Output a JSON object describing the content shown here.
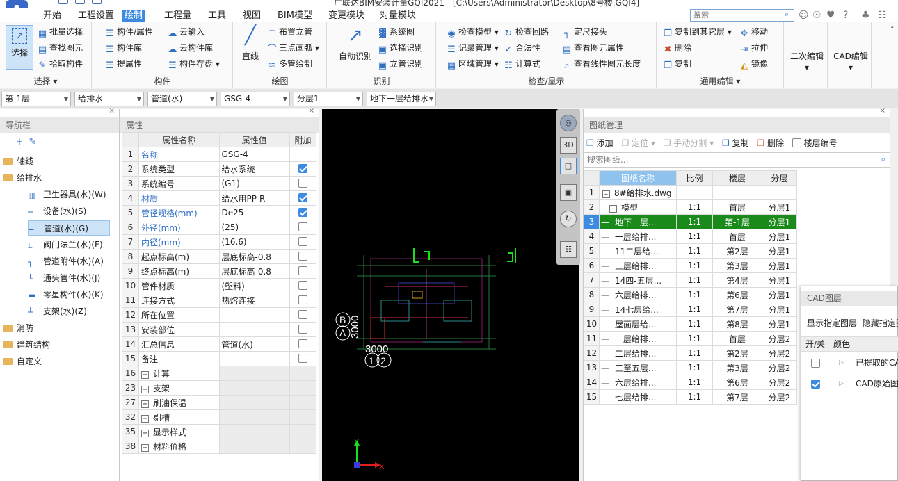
{
  "title": "广联达BIM安装计量GQI2021 - [C:\\Users\\Administrator\\Desktop\\8号楼.GQI4]",
  "menu": [
    "开始",
    "工程设置",
    "绘制",
    "工程量",
    "工具",
    "视图",
    "BIM模型",
    "变更模块",
    "对量模块"
  ],
  "search_placeholder": "搜索",
  "ribbon": {
    "select": {
      "label": "选择",
      "group": "选择 ▾"
    },
    "select_small": [
      "批量选择",
      "查找图元",
      "拾取构件"
    ],
    "component": {
      "items": [
        "构件/属性",
        "构件库",
        "提属性",
        "云输入",
        "云构件库",
        "构件存盘 ▾"
      ],
      "group": "构件"
    },
    "draw": {
      "big": "直线",
      "items": [
        "布置立管",
        "三点画弧 ▾",
        "多管绘制"
      ],
      "group": "绘图"
    },
    "identify": {
      "big": "自动识别",
      "items": [
        "系统图",
        "选择识别",
        "立管识别"
      ],
      "group": "识别"
    },
    "check": {
      "items": [
        "检查模型 ▾",
        "记录管理 ▾",
        "区域管理 ▾",
        "检查回路",
        "合法性",
        "计算式",
        "定尺接头",
        "查看图元属性",
        "查看线性图元长度"
      ],
      "group": "检查/显示"
    },
    "edit": {
      "items": [
        "复制到其它层 ▾",
        "删除",
        "复制",
        "移动",
        "拉伸",
        "镜像"
      ],
      "group": "通用编辑 ▾"
    },
    "second": "二次编辑",
    "cad": "CAD编辑"
  },
  "combos": [
    "第-1层",
    "给排水",
    "管道(水)",
    "GSG-4",
    "分层1",
    "地下一层给排水"
  ],
  "nav": {
    "title": "导航栏",
    "items": [
      {
        "label": "轴线",
        "type": "folder"
      },
      {
        "label": "给排水",
        "type": "folder"
      },
      {
        "label": "卫生器具(水)(W)",
        "type": "sub",
        "icon": "sanitary-icon"
      },
      {
        "label": "设备(水)(S)",
        "type": "sub",
        "icon": "equipment-icon"
      },
      {
        "label": "管道(水)(G)",
        "type": "sub",
        "icon": "pipe-icon",
        "selected": true
      },
      {
        "label": "阀门法兰(水)(F)",
        "type": "sub",
        "icon": "valve-icon"
      },
      {
        "label": "管道附件(水)(A)",
        "type": "sub",
        "icon": "pipe-fitting-icon"
      },
      {
        "label": "通头管件(水)(J)",
        "type": "sub",
        "icon": "tee-icon"
      },
      {
        "label": "零星构件(水)(K)",
        "type": "sub",
        "icon": "misc-part-icon"
      },
      {
        "label": "支架(水)(Z)",
        "type": "sub",
        "icon": "bracket-icon"
      },
      {
        "label": "消防",
        "type": "folder"
      },
      {
        "label": "建筑结构",
        "type": "folder"
      },
      {
        "label": "自定义",
        "type": "folder"
      }
    ]
  },
  "attr": {
    "title": "属性",
    "headers": [
      "属性名称",
      "属性值",
      "附加"
    ],
    "rows": [
      {
        "n": "1",
        "name": "名称",
        "val": "GSG-4",
        "blue": true,
        "check": null
      },
      {
        "n": "2",
        "name": "系统类型",
        "val": "给水系统",
        "blue": false,
        "check": true
      },
      {
        "n": "3",
        "name": "系统编号",
        "val": "(G1)",
        "blue": false,
        "check": false
      },
      {
        "n": "4",
        "name": "材质",
        "val": "给水用PP-R",
        "blue": true,
        "check": true
      },
      {
        "n": "5",
        "name": "管径规格(mm)",
        "val": "De25",
        "blue": true,
        "check": true
      },
      {
        "n": "6",
        "name": "外径(mm)",
        "val": "(25)",
        "blue": true,
        "check": false
      },
      {
        "n": "7",
        "name": "内径(mm)",
        "val": "(16.6)",
        "blue": true,
        "check": false
      },
      {
        "n": "8",
        "name": "起点标高(m)",
        "val": "层底标高-0.8",
        "blue": false,
        "check": false
      },
      {
        "n": "9",
        "name": "终点标高(m)",
        "val": "层底标高-0.8",
        "blue": false,
        "check": false
      },
      {
        "n": "10",
        "name": "管件材质",
        "val": "(塑料)",
        "blue": false,
        "check": false
      },
      {
        "n": "11",
        "name": "连接方式",
        "val": "热熔连接",
        "blue": false,
        "check": false
      },
      {
        "n": "12",
        "name": "所在位置",
        "val": "",
        "blue": false,
        "check": false
      },
      {
        "n": "13",
        "name": "安装部位",
        "val": "",
        "blue": false,
        "check": false
      },
      {
        "n": "14",
        "name": "汇总信息",
        "val": "管道(水)",
        "blue": false,
        "check": false
      },
      {
        "n": "15",
        "name": "备注",
        "val": "",
        "blue": false,
        "check": false
      }
    ],
    "groups": [
      {
        "n": "16",
        "name": "计算"
      },
      {
        "n": "23",
        "name": "支架"
      },
      {
        "n": "27",
        "name": "刷油保温"
      },
      {
        "n": "32",
        "name": "剔槽"
      },
      {
        "n": "35",
        "name": "显示样式"
      },
      {
        "n": "38",
        "name": "材料价格"
      }
    ]
  },
  "canvas": {
    "labels": [
      "B",
      "A",
      "3000",
      "3000",
      "1",
      "2"
    ],
    "axis_x": "X",
    "axis_y": "Y"
  },
  "drawings": {
    "title": "图纸管理",
    "toolbar": [
      "添加",
      "定位 ▾",
      "手动分割 ▾",
      "复制",
      "删除",
      "楼层编号"
    ],
    "search_placeholder": "搜索图纸...",
    "headers": [
      "图纸名称",
      "比例",
      "楼层",
      "分层"
    ],
    "rows": [
      {
        "n": "1",
        "name": "8#给排水.dwg",
        "scale": "",
        "floor": "",
        "layer": ""
      },
      {
        "n": "2",
        "name": "模型",
        "scale": "1:1",
        "floor": "首层",
        "layer": "分层1"
      },
      {
        "n": "3",
        "name": "地下一层...",
        "scale": "1:1",
        "floor": "第-1层",
        "layer": "分层1",
        "selected": true
      },
      {
        "n": "4",
        "name": "一层给排...",
        "scale": "1:1",
        "floor": "首层",
        "layer": "分层1"
      },
      {
        "n": "5",
        "name": "11二层给...",
        "scale": "1:1",
        "floor": "第2层",
        "layer": "分层1"
      },
      {
        "n": "6",
        "name": "三层给排...",
        "scale": "1:1",
        "floor": "第3层",
        "layer": "分层1"
      },
      {
        "n": "7",
        "name": "14四-五层...",
        "scale": "1:1",
        "floor": "第4层",
        "layer": "分层1"
      },
      {
        "n": "8",
        "name": "六层给排...",
        "scale": "1:1",
        "floor": "第6层",
        "layer": "分层1"
      },
      {
        "n": "9",
        "name": "14七层给...",
        "scale": "1:1",
        "floor": "第7层",
        "layer": "分层1"
      },
      {
        "n": "10",
        "name": "屋面层给...",
        "scale": "1:1",
        "floor": "第8层",
        "layer": "分层1"
      },
      {
        "n": "11",
        "name": "一层给排...",
        "scale": "1:1",
        "floor": "首层",
        "layer": "分层2"
      },
      {
        "n": "12",
        "name": "二层给排...",
        "scale": "1:1",
        "floor": "第2层",
        "layer": "分层2"
      },
      {
        "n": "13",
        "name": "三至五层...",
        "scale": "1:1",
        "floor": "第3层",
        "layer": "分层2"
      },
      {
        "n": "14",
        "name": "六层给排...",
        "scale": "1:1",
        "floor": "第6层",
        "layer": "分层2"
      },
      {
        "n": "15",
        "name": "七层给排...",
        "scale": "1:1",
        "floor": "第7层",
        "layer": "分层2"
      }
    ]
  },
  "cad_layers": {
    "title": "CAD图层",
    "tabs": [
      "显示指定图层",
      "隐藏指定图"
    ],
    "headers": [
      "开/关",
      "颜色"
    ],
    "rows": [
      {
        "label": "已提取的CA",
        "on": false
      },
      {
        "label": "CAD原始图",
        "on": true
      }
    ]
  }
}
